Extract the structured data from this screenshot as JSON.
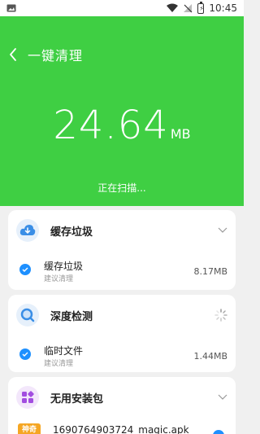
{
  "status_bar": {
    "time": "10:45"
  },
  "header": {
    "title": "一键清理",
    "size_value": "24.64",
    "size_unit": "MB",
    "status": "正在扫描..."
  },
  "cards": [
    {
      "title": "缓存垃圾",
      "item": {
        "name": "缓存垃圾",
        "sub": "建议清理",
        "size": "8.17MB"
      }
    },
    {
      "title": "深度检测",
      "item": {
        "name": "临时文件",
        "sub": "建议清理",
        "size": "1.44MB"
      }
    },
    {
      "title": "无用安装包",
      "item": {
        "badge": "神奇",
        "name": "1690764903724_magic.apk"
      }
    }
  ],
  "colors": {
    "accent_green": "#3fcf43",
    "check_blue": "#1e90ff",
    "cache_icon_bg": "#e6f0fb",
    "deep_icon_bg": "#e6f0fb",
    "apk_icon_bg": "#f3e7fb"
  }
}
